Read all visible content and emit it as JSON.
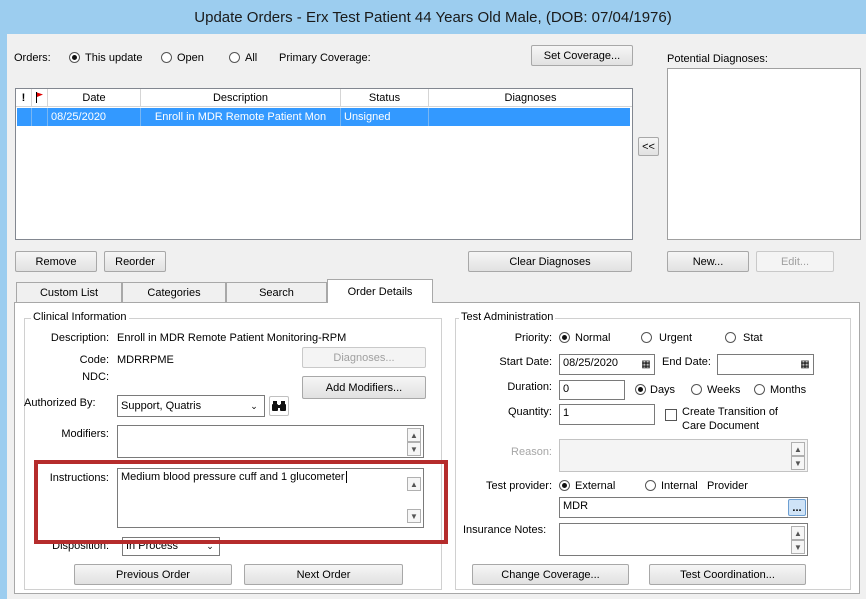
{
  "window": {
    "title": "Update Orders - Erx Test Patient 44 Years Old Male, (DOB: 07/04/1976)"
  },
  "orders_filter": {
    "label": "Orders:",
    "options": [
      {
        "label": "This update",
        "selected": true
      },
      {
        "label": "Open",
        "selected": false
      },
      {
        "label": "All",
        "selected": false
      }
    ],
    "primary_coverage_label": "Primary Coverage:",
    "set_coverage_button": "Set Coverage..."
  },
  "potential_diagnoses": {
    "label": "Potential Diagnoses:"
  },
  "orders_grid": {
    "columns": [
      "!",
      "",
      "Date",
      "Description",
      "Status",
      "Diagnoses"
    ],
    "rows": [
      {
        "date": "08/25/2020",
        "description": "Enroll in MDR Remote Patient Mon",
        "status": "Unsigned",
        "diagnoses": ""
      }
    ]
  },
  "move_button": "<<",
  "buttons": {
    "remove": "Remove",
    "reorder": "Reorder",
    "clear_diagnoses": "Clear Diagnoses",
    "new": "New...",
    "edit": "Edit..."
  },
  "tabs": [
    {
      "label": "Custom List",
      "active": false
    },
    {
      "label": "Categories",
      "active": false
    },
    {
      "label": "Search",
      "active": false
    },
    {
      "label": "Order Details",
      "active": true
    }
  ],
  "clinical": {
    "group_title": "Clinical Information",
    "description_label": "Description:",
    "description_value": "Enroll in MDR Remote Patient Monitoring-RPM",
    "code_label": "Code:",
    "code_value": "MDRRPME",
    "ndc_label": "NDC:",
    "diagnoses_button": "Diagnoses...",
    "add_modifiers_button": "Add Modifiers...",
    "authorized_by_label": "Authorized By:",
    "authorized_by_value": "Support, Quatris",
    "modifiers_label": "Modifiers:",
    "instructions_label": "Instructions:",
    "instructions_value": "Medium blood pressure cuff and 1 glucometer",
    "disposition_label": "Disposition:",
    "disposition_value": "In Process",
    "previous_order_button": "Previous Order",
    "next_order_button": "Next Order"
  },
  "test_admin": {
    "group_title": "Test Administration",
    "priority_label": "Priority:",
    "priority_options": [
      {
        "label": "Normal",
        "selected": true
      },
      {
        "label": "Urgent",
        "selected": false
      },
      {
        "label": "Stat",
        "selected": false
      }
    ],
    "start_date_label": "Start Date:",
    "start_date_value": "08/25/2020",
    "end_date_label": "End Date:",
    "end_date_value": "",
    "duration_label": "Duration:",
    "duration_value": "0",
    "duration_units": [
      {
        "label": "Days",
        "selected": true
      },
      {
        "label": "Weeks",
        "selected": false
      },
      {
        "label": "Months",
        "selected": false
      }
    ],
    "quantity_label": "Quantity:",
    "quantity_value": "1",
    "transition_checkbox_line1": "Create Transition of",
    "transition_checkbox_line2": "Care Document",
    "reason_label": "Reason:",
    "test_provider_label": "Test provider:",
    "provider_options": [
      {
        "label": "External",
        "selected": true
      },
      {
        "label": "Internal",
        "selected": false
      }
    ],
    "provider_label": "Provider",
    "provider_value": "MDR",
    "ellipsis": "...",
    "insurance_notes_label": "Insurance Notes:",
    "change_coverage_button": "Change Coverage...",
    "test_coordination_button": "Test Coordination..."
  }
}
